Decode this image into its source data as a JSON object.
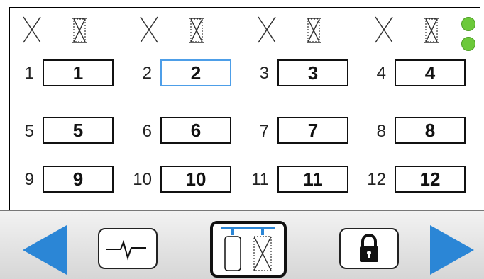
{
  "status": {
    "indicators": [
      "green",
      "green"
    ]
  },
  "channels": [
    {
      "num": "1",
      "label": "1"
    },
    {
      "num": "2",
      "label": "2",
      "selected": true
    },
    {
      "num": "3",
      "label": "3"
    },
    {
      "num": "4",
      "label": "4"
    },
    {
      "num": "5",
      "label": "5"
    },
    {
      "num": "6",
      "label": "6"
    },
    {
      "num": "7",
      "label": "7"
    },
    {
      "num": "8",
      "label": "8"
    },
    {
      "num": "9",
      "label": "9"
    },
    {
      "num": "10",
      "label": "10"
    },
    {
      "num": "11",
      "label": "11"
    },
    {
      "num": "12",
      "label": "12"
    }
  ],
  "toolbar": {
    "buttons": [
      "prev-arrow",
      "waveform",
      "bus-config",
      "lock",
      "next-arrow"
    ]
  },
  "colors": {
    "accent_blue": "#2b86d6",
    "selected_border": "#4d9ee8",
    "status_green": "#6cc93a"
  }
}
